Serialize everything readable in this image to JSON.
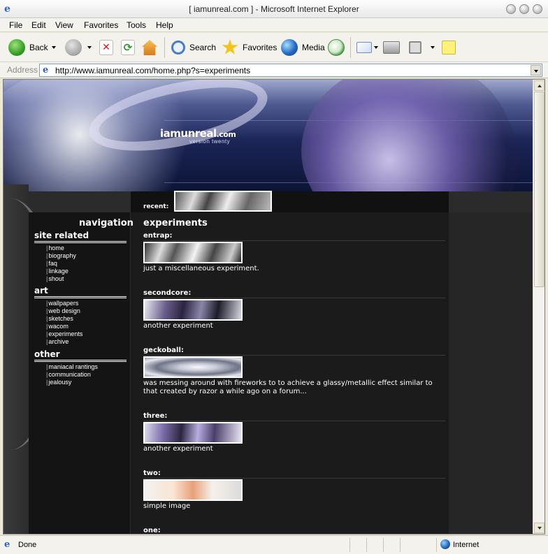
{
  "window": {
    "title": "[ iamunreal.com ] - Microsoft Internet Explorer"
  },
  "menu": [
    "File",
    "Edit",
    "View",
    "Favorites",
    "Tools",
    "Help"
  ],
  "toolbar": {
    "back": "Back",
    "search": "Search",
    "favorites": "Favorites",
    "media": "Media"
  },
  "address": {
    "label": "Address",
    "url": "http://www.iamunreal.com/home.php?s=experiments"
  },
  "site": {
    "logo": "iamunreal",
    "logo_tld": ".com",
    "logo_sub": "version twenty",
    "recent_label": "recent:",
    "nav_title": "navigation",
    "section_title": "experiments",
    "nav": [
      {
        "heading": "site related",
        "links": [
          "home",
          "biography",
          "faq",
          "linkage",
          "shout"
        ]
      },
      {
        "heading": "art",
        "links": [
          "wallpapers",
          "web design",
          "sketches",
          "wacom",
          "experiments",
          "archive"
        ]
      },
      {
        "heading": "other",
        "links": [
          "maniacal rantings",
          "communication",
          "jealousy"
        ]
      }
    ],
    "entries": [
      {
        "title": "entrap:",
        "desc": "just a miscellaneous experiment."
      },
      {
        "title": "secondcore:",
        "desc": "another experiment"
      },
      {
        "title": "geckoball:",
        "desc": "was messing around with fireworks to to achieve a glassy/metallic effect similar to that created by razor a while ago on a forum..."
      },
      {
        "title": "three:",
        "desc": "another experiment"
      },
      {
        "title": "two:",
        "desc": "simple image"
      },
      {
        "title": "one:",
        "desc": ""
      }
    ]
  },
  "status": {
    "text": "Done",
    "zone": "Internet"
  },
  "colors": {
    "page_bg": "#2b2b2b",
    "content_bg": "#1b1b1b",
    "sidebar_bg": "#141414",
    "header_blue": "#1b2556",
    "accent_purple": "#9d8fd0"
  }
}
